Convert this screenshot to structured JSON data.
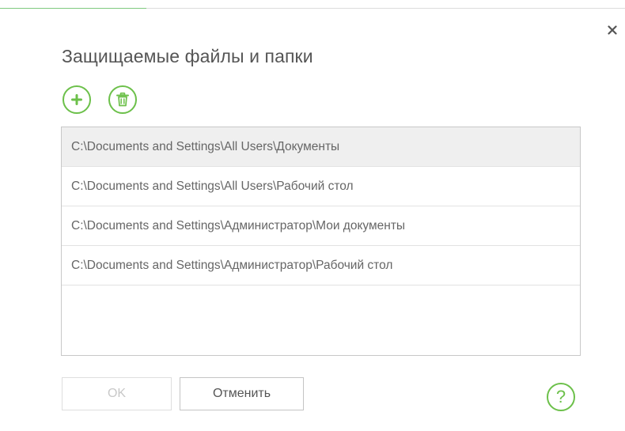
{
  "dialog": {
    "title": "Защищаемые файлы и папки",
    "close_icon": "close-icon"
  },
  "toolbar": {
    "add_icon": "plus-icon",
    "delete_icon": "trash-icon"
  },
  "list": {
    "selected_index": 0,
    "items": [
      {
        "path": "C:\\Documents and Settings\\All Users\\Документы"
      },
      {
        "path": "C:\\Documents and Settings\\All Users\\Рабочий стол"
      },
      {
        "path": "C:\\Documents and Settings\\Администратор\\Мои документы"
      },
      {
        "path": "C:\\Documents and Settings\\Администратор\\Рабочий стол"
      }
    ]
  },
  "buttons": {
    "ok_label": "OK",
    "ok_enabled": false,
    "cancel_label": "Отменить",
    "help_label": "?"
  },
  "colors": {
    "accent": "#6cc04a",
    "title_text": "#555555",
    "row_text": "#666666",
    "selected_row_bg": "#efefef",
    "border": "#c8c8c8"
  }
}
